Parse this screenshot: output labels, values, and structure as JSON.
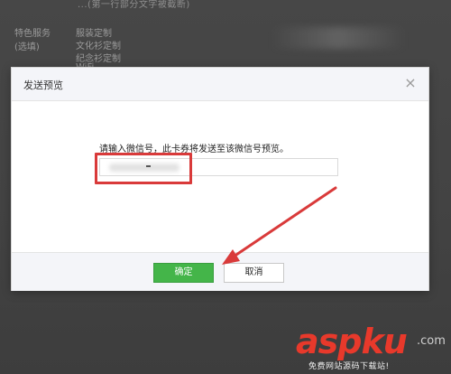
{
  "background": {
    "top_line": "...(第一行部分文字被截断)",
    "service_label": "特色服务",
    "service_note": "(选填)",
    "services": [
      "服装定制",
      "文化衫定制",
      "纪念衫定制",
      "WiFi"
    ]
  },
  "dialog": {
    "title": "发送预览",
    "close_symbol": "×",
    "prompt": "请输入微信号，此卡券将发送至该微信号预览。",
    "input_value": "",
    "confirm_label": "确定",
    "cancel_label": "取消"
  },
  "annotation": {
    "color": "#d93a3a"
  },
  "watermark": {
    "brand_main": "asp",
    "brand_ku": "ku",
    "brand_tld": ".com",
    "tagline": "免费网站源码下载站!"
  },
  "colors": {
    "confirm_green": "#44b549",
    "annotation_red": "#d93a3a"
  }
}
